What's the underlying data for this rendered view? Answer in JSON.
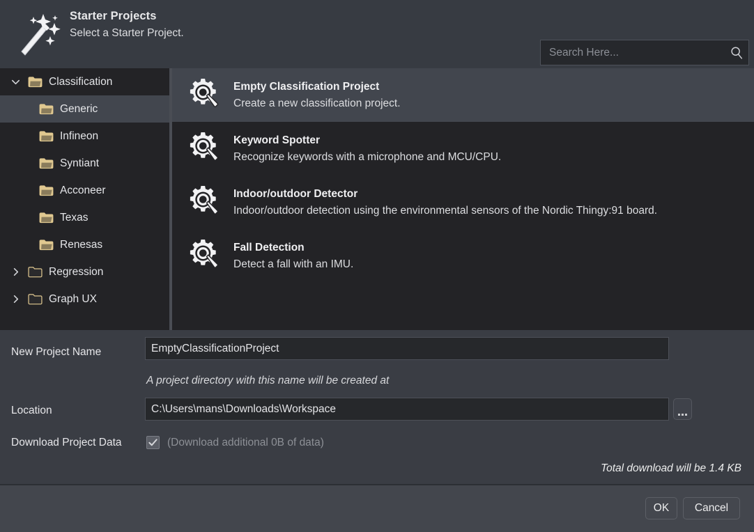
{
  "header": {
    "title": "Starter Projects",
    "subtitle": "Select a Starter Project.",
    "icon": "magic-wand-icon"
  },
  "search": {
    "placeholder": "Search Here...",
    "value": "",
    "icon": "search-icon"
  },
  "tree": {
    "items": [
      {
        "label": "Classification",
        "level": 0,
        "expanded": true,
        "chevron": "chevron-down-icon",
        "folder": "folder-open-icon",
        "selected": false
      },
      {
        "label": "Generic",
        "level": 1,
        "expanded": false,
        "chevron": "",
        "folder": "folder-open-icon",
        "selected": true
      },
      {
        "label": "Infineon",
        "level": 1,
        "expanded": false,
        "chevron": "",
        "folder": "folder-open-icon",
        "selected": false
      },
      {
        "label": "Syntiant",
        "level": 1,
        "expanded": false,
        "chevron": "",
        "folder": "folder-open-icon",
        "selected": false
      },
      {
        "label": "Acconeer",
        "level": 1,
        "expanded": false,
        "chevron": "",
        "folder": "folder-open-icon",
        "selected": false
      },
      {
        "label": "Texas",
        "level": 1,
        "expanded": false,
        "chevron": "",
        "folder": "folder-open-icon",
        "selected": false
      },
      {
        "label": "Renesas",
        "level": 1,
        "expanded": false,
        "chevron": "",
        "folder": "folder-open-icon",
        "selected": false
      },
      {
        "label": "Regression",
        "level": 0,
        "expanded": false,
        "chevron": "chevron-right-icon",
        "folder": "folder-closed-icon",
        "selected": false
      },
      {
        "label": "Graph UX",
        "level": 0,
        "expanded": false,
        "chevron": "chevron-right-icon",
        "folder": "folder-closed-icon",
        "selected": false
      }
    ]
  },
  "projects": {
    "items": [
      {
        "title": "Empty Classification Project",
        "description": "Create a new classification project.",
        "icon": "gear-search-icon",
        "selected": true
      },
      {
        "title": "Keyword Spotter",
        "description": "Recognize keywords with a microphone and MCU/CPU.",
        "icon": "gear-search-icon",
        "selected": false
      },
      {
        "title": "Indoor/outdoor Detector",
        "description": "Indoor/outdoor detection using the environmental sensors of the Nordic Thingy:91 board.",
        "icon": "gear-search-icon",
        "selected": false
      },
      {
        "title": "Fall Detection",
        "description": "Detect a fall with an IMU.",
        "icon": "gear-search-icon",
        "selected": false
      }
    ]
  },
  "form": {
    "project_name_label": "New Project Name",
    "project_name_value": "EmptyClassificationProject",
    "project_dir_hint": "A project directory with this name will be created at",
    "location_label": "Location",
    "location_value": "C:\\Users\\mans\\Downloads\\Workspace",
    "browse_label": "...",
    "download_label": "Download Project Data",
    "download_checked": true,
    "download_note": "(Download additional 0B of data)",
    "total_download": "Total download will be 1.4 KB"
  },
  "footer": {
    "ok_label": "OK",
    "cancel_label": "Cancel"
  },
  "colors": {
    "header_bg": "#373b42",
    "panel_bg": "#232326",
    "form_bg": "#3a3d44",
    "footer_bg": "#43464d",
    "selection": "#42464e",
    "folder_accent": "#e0c890",
    "field_bg": "#26282b",
    "text": "#e4e5e8",
    "dim_text": "#8d9096"
  }
}
